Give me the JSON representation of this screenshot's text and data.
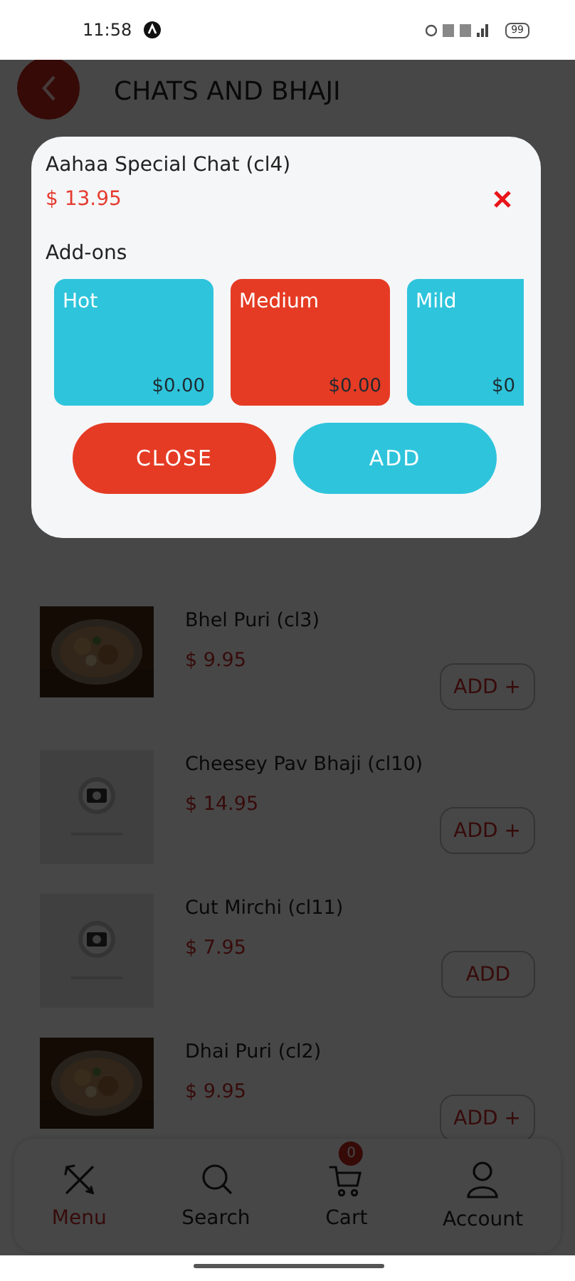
{
  "status_bar": {
    "time": "11:58",
    "battery": "99"
  },
  "header": {
    "title": "CHATS AND BHAJI"
  },
  "items": [
    {
      "name": "Bhel Puri (cl3)",
      "price": "$ 9.95",
      "button": "ADD +"
    },
    {
      "name": "Cheesey Pav Bhaji (cl10)",
      "price": "$ 14.95",
      "button": "ADD +",
      "kind": "placeholder"
    },
    {
      "name": "Cut Mirchi (cl11)",
      "price": "$ 7.95",
      "button": "ADD",
      "kind": "placeholder"
    },
    {
      "name": "Dhai Puri (cl2)",
      "price": "$ 9.95",
      "button": "ADD +"
    }
  ],
  "nav": [
    {
      "label": "Menu",
      "kind": "menu",
      "selected": true
    },
    {
      "label": "Search",
      "kind": "search",
      "selected": false
    },
    {
      "label": "Cart",
      "kind": "cart",
      "selected": false,
      "badge": "0"
    },
    {
      "label": "Account",
      "kind": "account",
      "selected": false
    }
  ],
  "dialog": {
    "title": "Aahaa Special Chat (cl4)",
    "price": "$ 13.95",
    "addons_label": "Add-ons",
    "addons": [
      {
        "name": "Hot",
        "price": "$0.00",
        "selected": false
      },
      {
        "name": "Medium",
        "price": "$0.00",
        "selected": true
      },
      {
        "name": "Mild",
        "price": "$0",
        "selected": false
      }
    ],
    "buttons": [
      {
        "label": "CLOSE",
        "kind": "close"
      },
      {
        "label": "ADD",
        "kind": "add"
      }
    ]
  }
}
